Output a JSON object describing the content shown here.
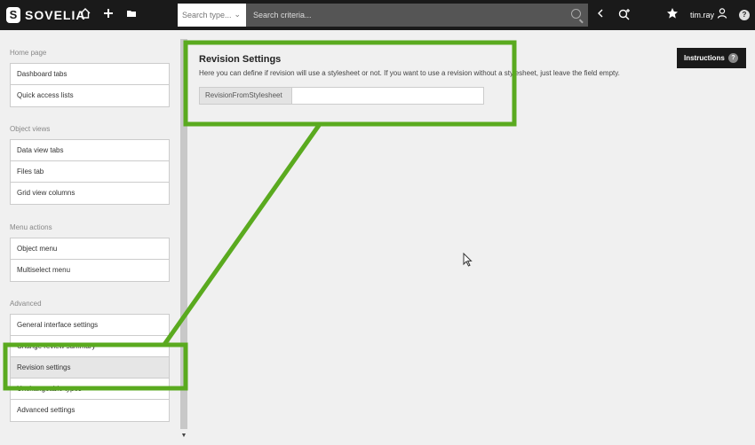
{
  "header": {
    "logo_letter": "S",
    "logo_text": "SOVELIA",
    "home_icon": "home-icon",
    "add_icon": "plus-icon",
    "folder_icon": "folder-icon",
    "search_type_placeholder": "Search type...",
    "search_placeholder": "Search criteria...",
    "back_icon": "chevron-left-icon",
    "advanced_search_icon": "search-plus-icon",
    "favorite_icon": "star-icon",
    "user_name": "tim.ray",
    "user_icon": "user-icon",
    "help_label": "?"
  },
  "sidebar": {
    "sections": [
      {
        "title": "Home page",
        "items": [
          "Dashboard tabs",
          "Quick access lists"
        ]
      },
      {
        "title": "Object views",
        "items": [
          "Data view tabs",
          "Files tab",
          "Grid view columns"
        ]
      },
      {
        "title": "Menu actions",
        "items": [
          "Object menu",
          "Multiselect menu"
        ]
      },
      {
        "title": "Advanced",
        "items": [
          "General interface settings",
          "Change review summary",
          "Revision settings",
          "Unchangeable types",
          "Advanced settings"
        ]
      }
    ],
    "active_item": "Revision settings"
  },
  "main": {
    "title": "Revision Settings",
    "description": "Here you can define if revision will use a stylesheet or not. If you want to use a revision without a stylesheet, just leave the field empty.",
    "field_label": "RevisionFromStylesheet",
    "field_value": "",
    "instructions_label": "Instructions",
    "instructions_help": "?"
  },
  "colors": {
    "topbar": "#1a1a1a",
    "annotation_green": "#5aaa1f"
  }
}
